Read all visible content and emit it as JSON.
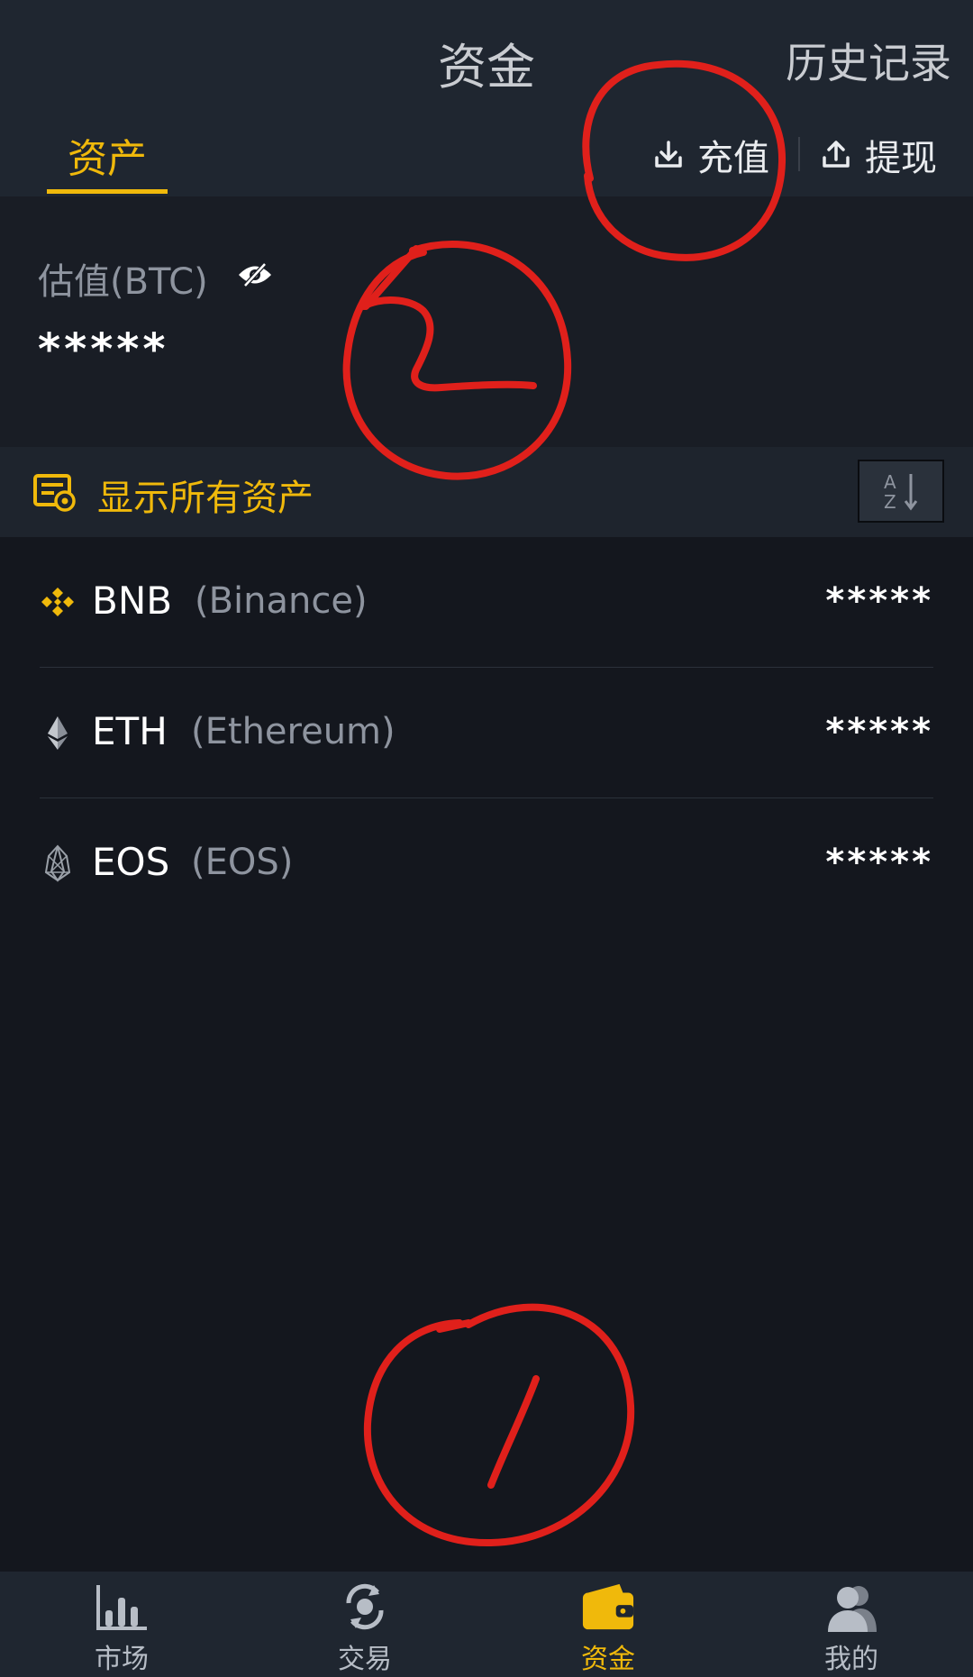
{
  "header": {
    "title": "资金",
    "history_label": "历史记录",
    "tab_assets": "资产",
    "deposit_label": "充值",
    "withdraw_label": "提现"
  },
  "estimate": {
    "label": "估值(BTC)",
    "value": "*****"
  },
  "filter": {
    "label": "显示所有资产"
  },
  "assets": [
    {
      "symbol": "BNB",
      "name": "(Binance)",
      "amount": "*****",
      "icon": "bnb-icon"
    },
    {
      "symbol": "ETH",
      "name": "(Ethereum)",
      "amount": "*****",
      "icon": "eth-icon"
    },
    {
      "symbol": "EOS",
      "name": "(EOS)",
      "amount": "*****",
      "icon": "eos-icon"
    }
  ],
  "bottom_nav": [
    {
      "label": "市场",
      "icon": "market-chart-icon",
      "active": false
    },
    {
      "label": "交易",
      "icon": "trade-exchange-icon",
      "active": false
    },
    {
      "label": "资金",
      "icon": "wallet-icon",
      "active": true
    },
    {
      "label": "我的",
      "icon": "profile-icon",
      "active": false
    }
  ],
  "colors": {
    "accent": "#f0b90b",
    "background": "#14171e",
    "header": "#1f2630",
    "annotation": "#e0201b"
  }
}
